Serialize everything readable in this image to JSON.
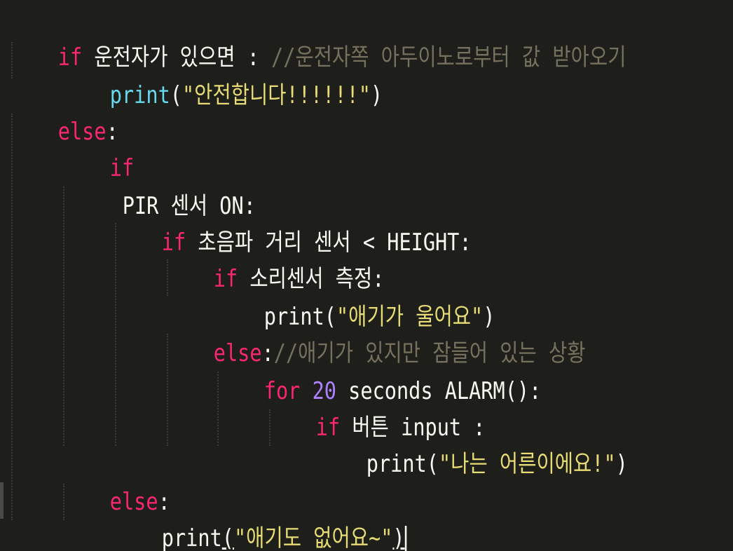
{
  "lines": {
    "l1": {
      "kw": "if",
      "text": " 운전자가 있으면 : ",
      "comment": "//운전자쪽 아두이노로부터 값 받아오기"
    },
    "l2": {
      "fn": "print",
      "open": "(",
      "str": "\"안전합니다!!!!!!\"",
      "close": ")"
    },
    "l3": {
      "kw": "else",
      "colon": ":"
    },
    "l4": {
      "kw": "if"
    },
    "l5": {
      "text": "PIR 센서 ON:"
    },
    "l6": {
      "kw": "if",
      "text": " 초음파 거리 센서 < HEIGHT:"
    },
    "l7": {
      "kw": "if",
      "text": " 소리센서 측정:"
    },
    "l8": {
      "fn": "print",
      "open": "(",
      "str": "\"애기가 울어요\"",
      "close": ")"
    },
    "l9": {
      "kw": "else",
      "colon": ":",
      "comment": "//애기가 있지만 잠들어 있는 상황"
    },
    "l10": {
      "kw": "for",
      "num": "20",
      "text": " seconds ALARM():"
    },
    "l11": {
      "kw": "if",
      "text": " 버튼 input :"
    },
    "l12": {
      "fn": "print",
      "open": "(",
      "str": "\"나는 어른이에요!\"",
      "close": ")"
    },
    "l13": {
      "kw": "else",
      "colon": ":"
    },
    "l14": {
      "fn": "print",
      "open": "(",
      "str": "\"애기도 없어요~\"",
      "close": ")"
    }
  }
}
